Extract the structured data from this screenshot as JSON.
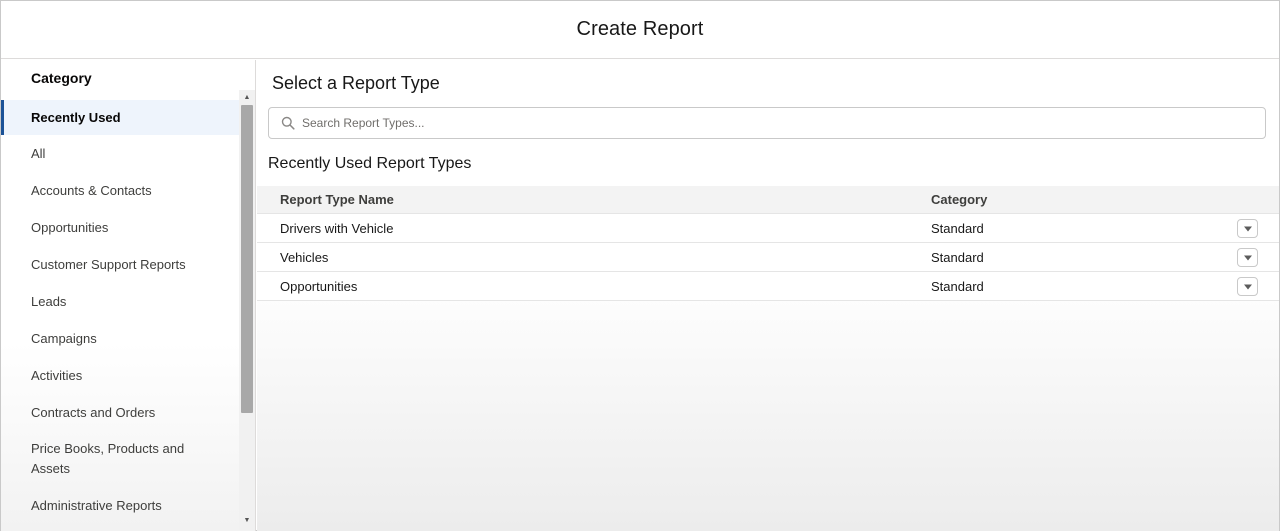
{
  "header": {
    "title": "Create Report"
  },
  "sidebar": {
    "heading": "Category",
    "items": [
      {
        "label": "Recently Used",
        "active": true
      },
      {
        "label": "All"
      },
      {
        "label": "Accounts & Contacts"
      },
      {
        "label": "Opportunities"
      },
      {
        "label": "Customer Support Reports"
      },
      {
        "label": "Leads"
      },
      {
        "label": "Campaigns"
      },
      {
        "label": "Activities"
      },
      {
        "label": "Contracts and Orders"
      },
      {
        "label": "Price Books, Products and Assets"
      },
      {
        "label": "Administrative Reports"
      }
    ]
  },
  "main": {
    "title": "Select a Report Type",
    "search": {
      "placeholder": "Search Report Types...",
      "value": ""
    },
    "section_title": "Recently Used Report Types",
    "table": {
      "columns": [
        "Report Type Name",
        "Category"
      ],
      "rows": [
        {
          "name": "Drivers with Vehicle",
          "category": "Standard"
        },
        {
          "name": "Vehicles",
          "category": "Standard"
        },
        {
          "name": "Opportunities",
          "category": "Standard"
        }
      ]
    }
  },
  "icons": {
    "search": "search-icon",
    "row_menu": "chevron-down-icon",
    "scroll_up": "arrow-up-icon",
    "scroll_down": "arrow-down-icon"
  }
}
